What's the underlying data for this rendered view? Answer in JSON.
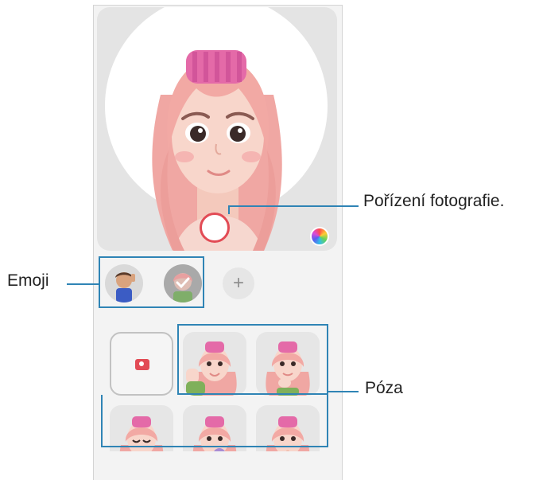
{
  "callouts": {
    "capture": "Pořízení fotografie.",
    "emoji": "Emoji",
    "pose": "Póza"
  },
  "emoji_row": {
    "add_symbol": "+"
  },
  "colors": {
    "callout_line": "#2f84b5",
    "shutter_ring": "#e24b55",
    "hair": "#f2a9a4",
    "hair_roller": "#e46aa8",
    "background": "#e4e4e4"
  },
  "icons": [
    "camera-icon",
    "color-palette-icon",
    "plus-icon"
  ]
}
